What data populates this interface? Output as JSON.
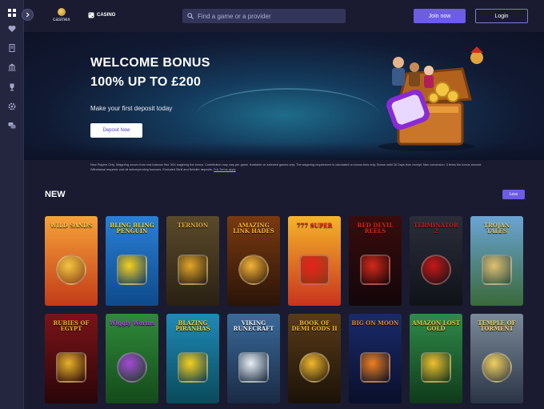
{
  "brand": {
    "name": "casinex"
  },
  "nav": {
    "casino_label": "CASINO"
  },
  "search": {
    "placeholder": "Find a game or a provider"
  },
  "auth": {
    "join_label": "Join now",
    "login_label": "Login"
  },
  "sidebar": {
    "icons": [
      "grid-icon",
      "heart-icon",
      "document-icon",
      "bank-icon",
      "trophy-icon",
      "settings-icon",
      "chat-icon"
    ]
  },
  "hero": {
    "title_line1": "WELCOME BONUS",
    "title_line2": "100% UP TO £200",
    "subtitle": "Make your first deposit today",
    "cta_label": "Deposit Now"
  },
  "terms": {
    "text": "New Players Only. Wagering occurs from real balance first. 50X wagering the bonus. Contribution may vary per game. Available on selected games only. The wagering requirement is calculated on bonus bets only. Bonus valid 30 Days from receipt. Max conversion: 3 times the bonus amount. Withdrawal requests void all active/pending bonuses. Excluded Skrill and Neteller deposits.",
    "link_label": "Full Terms apply"
  },
  "section": {
    "title": "NEW",
    "toggle_label": "Less"
  },
  "games": [
    {
      "title": "WILD SANDS",
      "bg1": "#f6a23a",
      "bg2": "#c23b18",
      "accent": "#f4c542"
    },
    {
      "title": "BLING BLING PENGUIN",
      "bg1": "#2a7fd6",
      "bg2": "#0d4a8a",
      "accent": "#f5d020"
    },
    {
      "title": "TERNION",
      "bg1": "#5a4a2a",
      "bg2": "#2a2114",
      "accent": "#e2a52a"
    },
    {
      "title": "AMAZING LINK HADES",
      "bg1": "#7a3a10",
      "bg2": "#2a1408",
      "accent": "#f3b43a"
    },
    {
      "title": "777 SUPER",
      "bg1": "#f5b52a",
      "bg2": "#c9331d",
      "accent": "#e8201c"
    },
    {
      "title": "RED DEVIL REELS",
      "bg1": "#3a0c0c",
      "bg2": "#12060a",
      "accent": "#d42a1c"
    },
    {
      "title": "TERMINATOR 2",
      "bg1": "#2a2e3a",
      "bg2": "#0f1218",
      "accent": "#c81818"
    },
    {
      "title": "TROJAN TALES",
      "bg1": "#6aa4d4",
      "bg2": "#3a6a3a",
      "accent": "#e0c070"
    },
    {
      "title": "RUBIES OF EGYPT",
      "bg1": "#7a1418",
      "bg2": "#2a0508",
      "accent": "#e6b42a"
    },
    {
      "title": "Wiggly Worms",
      "bg1": "#2f8a3a",
      "bg2": "#144a1a",
      "accent": "#a44ad6"
    },
    {
      "title": "BLAZING PIRANHAS",
      "bg1": "#1f8ab8",
      "bg2": "#0a4a5a",
      "accent": "#f5d020"
    },
    {
      "title": "VIKING RUNECRAFT",
      "bg1": "#3a6a9a",
      "bg2": "#1a2a44",
      "accent": "#e8eef4"
    },
    {
      "title": "BOOK OF DEMI GODS II",
      "bg1": "#5a3a18",
      "bg2": "#1a1208",
      "accent": "#f0b830"
    },
    {
      "title": "BIG ON MOON",
      "bg1": "#1a2a6a",
      "bg2": "#0a0f2a",
      "accent": "#f08020"
    },
    {
      "title": "AMAZON LOST GOLD",
      "bg1": "#2f8a4a",
      "bg2": "#0f3a1a",
      "accent": "#f0c030"
    },
    {
      "title": "TEMPLE OF TORMENT",
      "bg1": "#7a8a9a",
      "bg2": "#2a3444",
      "accent": "#f0d060"
    }
  ]
}
